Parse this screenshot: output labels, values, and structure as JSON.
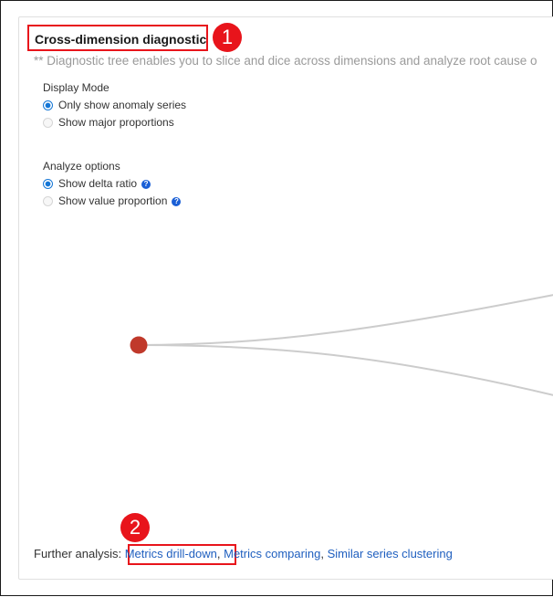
{
  "panel": {
    "title": "Cross-dimension diagnostic",
    "subtitle": "** Diagnostic tree enables you to slice and dice across dimensions and analyze root cause o"
  },
  "callouts": {
    "badge_1": "1",
    "badge_2": "2",
    "color": "#e8141b"
  },
  "display_mode": {
    "label": "Display Mode",
    "options": [
      {
        "label": "Only show anomaly series",
        "checked": true
      },
      {
        "label": "Show major proportions",
        "checked": false
      }
    ]
  },
  "analyze_options": {
    "label": "Analyze options",
    "options": [
      {
        "label": "Show delta ratio",
        "checked": true,
        "help_icon": "help-circle-icon"
      },
      {
        "label": "Show value proportion",
        "checked": false,
        "help_icon": "help-circle-icon"
      }
    ]
  },
  "tree": {
    "root_node_color": "#c0392b",
    "edge_color": "#cccccc"
  },
  "further_analysis": {
    "label": "Further analysis:",
    "links": [
      "Metrics drill-down",
      "Metrics comparing",
      "Similar series clustering"
    ],
    "separator": ","
  }
}
